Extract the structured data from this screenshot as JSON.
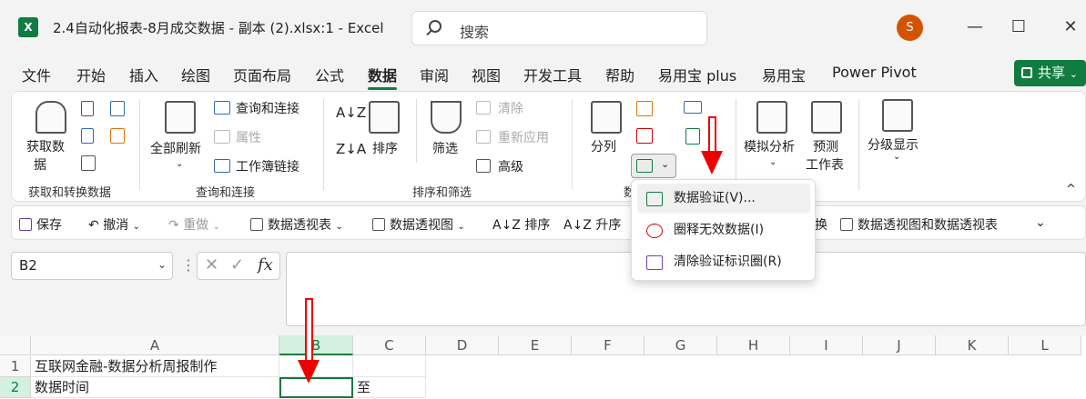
{
  "window": {
    "title": "2.4自动化报表-8月成交数据 - 副本 (2).xlsx:1  -  Excel",
    "app_icon": "X",
    "search_placeholder": "搜索",
    "avatar_initial": "S",
    "min_glyph": "—",
    "max_glyph": "☐",
    "close_glyph": "✕"
  },
  "menu": {
    "tabs": [
      "文件",
      "开始",
      "插入",
      "绘图",
      "页面布局",
      "公式",
      "数据",
      "审阅",
      "视图",
      "开发工具",
      "帮助",
      "易用宝 plus",
      "易用宝",
      "Power Pivot"
    ],
    "active_tab": "数据",
    "share_label": "共享",
    "share_chevron": "⌄"
  },
  "ribbon": {
    "get_data": {
      "label": "获取数",
      "label2": "据",
      "group_label": "获取和转换数据"
    },
    "queries": {
      "refresh_all": "全部刷新",
      "queries_connections": "查询和连接",
      "properties": "属性",
      "workbook_links": "工作簿链接",
      "group_label": "查询和连接"
    },
    "sort_filter": {
      "sort": "排序",
      "filter": "筛选",
      "clear": "清除",
      "reapply": "重新应用",
      "advanced": "高级",
      "group_label": "排序和筛选"
    },
    "data_tools": {
      "split": "分列",
      "group_label_fragment": "数"
    },
    "forecast": {
      "what_if": "模拟分析",
      "forecast_sheet": "预测",
      "forecast_sheet2": "工作表"
    },
    "outline": {
      "group": "分级显示"
    }
  },
  "dropdown": {
    "items": [
      {
        "label": "数据验证(V)...",
        "highlighted": true
      },
      {
        "label": "圈释无效数据(I)",
        "highlighted": false
      },
      {
        "label": "清除验证标识圈(R)",
        "highlighted": false
      }
    ]
  },
  "qat": {
    "save": "保存",
    "undo": "撤消",
    "redo": "重做",
    "pivot_table": "数据透视表",
    "pivot_chart": "数据透视图",
    "sort": "排序",
    "ascending": "升序",
    "pivot_chart_and_table": "数据透视图和数据透视表",
    "fragment": "换"
  },
  "formula_bar": {
    "name_box": "B2",
    "fx": "fx"
  },
  "sheet": {
    "columns": [
      "A",
      "B",
      "C",
      "D",
      "E",
      "F",
      "G",
      "H",
      "I",
      "J",
      "K",
      "L"
    ],
    "rows": [
      {
        "num": "1",
        "a": "互联网金融-数据分析周报制作",
        "b": "",
        "c": ""
      },
      {
        "num": "2",
        "a": "数据时间",
        "b": "",
        "c": "至"
      }
    ],
    "active_cell": "B2"
  },
  "colors": {
    "accent": "#107c41",
    "annotation_arrow": "#e00000"
  }
}
